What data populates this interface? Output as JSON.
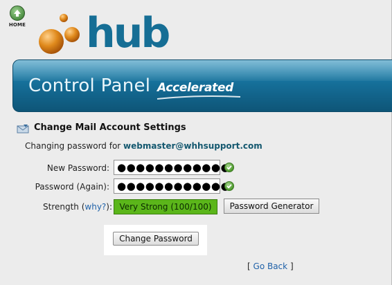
{
  "home": {
    "label": "HOME"
  },
  "logo": {
    "text": "hub"
  },
  "banner": {
    "title": "Control Panel",
    "accent": "Accelerated"
  },
  "section": {
    "title": "Change Mail Account Settings",
    "changing_prefix": "Changing password for",
    "account": "webmaster@whhsupport.com"
  },
  "form": {
    "new_password_label": "New Password:",
    "new_password_value": "●●●●●●●●●●●●",
    "confirm_password_label": "Password (Again):",
    "confirm_password_value": "●●●●●●●●●●●●",
    "strength_label": "Strength (",
    "why_link": "why?",
    "strength_suffix": "):",
    "strength_value": "Very Strong (100/100)",
    "generator_button": "Password Generator",
    "submit_button": "Change Password"
  },
  "footer": {
    "open_bracket": "[",
    "go_back": "Go Back",
    "close_bracket": "]"
  },
  "colors": {
    "brand_blue": "#166e95",
    "banner_blue": "#146a93",
    "strength_green": "#5bb61a",
    "link_blue": "#1f61a8",
    "logo_orange": "#e08a1c"
  }
}
